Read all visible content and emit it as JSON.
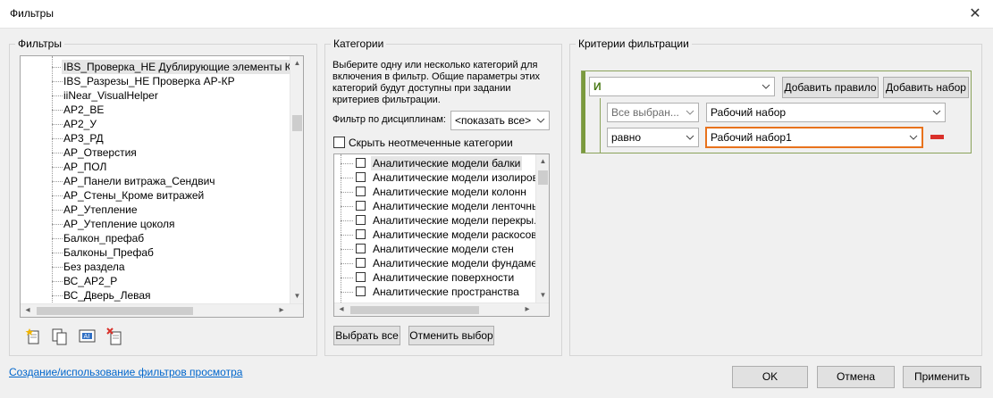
{
  "window": {
    "title": "Фильтры",
    "close_glyph": "✕"
  },
  "filters_group": {
    "label": "Фильтры",
    "items": [
      "IBS_Проверка_НЕ Дублирующие элементы КР",
      "IBS_Разрезы_НЕ Проверка АР-КР",
      "iiNear_VisualHelper",
      "АР2_ВЕ",
      "АР2_У",
      "АР3_РД",
      "АР_Отверстия",
      "АР_ПОЛ",
      "АР_Панели витража_Сендвич",
      "АР_Стены_Кроме витражей",
      "АР_Утепление",
      "АР_Утепление цоколя",
      "Балкон_префаб",
      "Балконы_Префаб",
      "Без раздела",
      "ВС_АР2_Р",
      "ВС_Дверь_Левая"
    ],
    "selected_index": 0
  },
  "categories_group": {
    "label": "Категории",
    "description": "Выберите одну или несколько категорий для включения в фильтр. Общие параметры этих категорий будут доступны при задании критериев фильтрации.",
    "discipline_label": "Фильтр по дисциплинам:",
    "discipline_value": "<показать все>",
    "hide_unchecked_label": "Скрыть неотмеченные категории",
    "items": [
      "Аналитические модели балки",
      "Аналитические модели изолирован",
      "Аналитические модели колонн",
      "Аналитические модели ленточных ф",
      "Аналитические модели перекры...",
      "Аналитические модели раскосов",
      "Аналитические модели стен",
      "Аналитические модели фундаментн",
      "Аналитические поверхности",
      "Аналитические пространства"
    ],
    "select_all": "Выбрать все",
    "deselect": "Отменить выбор"
  },
  "criteria_group": {
    "label": "Критерии фильтрации",
    "logic_value": "И",
    "add_rule": "Добавить правило",
    "add_set": "Добавить набор",
    "rule1_param": "Все выбран...",
    "rule1_value": "Рабочий набор",
    "rule2_operator": "равно",
    "rule2_value": "Рабочий набор1"
  },
  "footer": {
    "link": "Создание/использование фильтров просмотра",
    "ok": "OK",
    "cancel": "Отмена",
    "apply": "Применить"
  },
  "colors": {
    "accent_orange": "#e8721c",
    "rule_green": "#7b9a3d",
    "remove_red": "#d9302a"
  }
}
